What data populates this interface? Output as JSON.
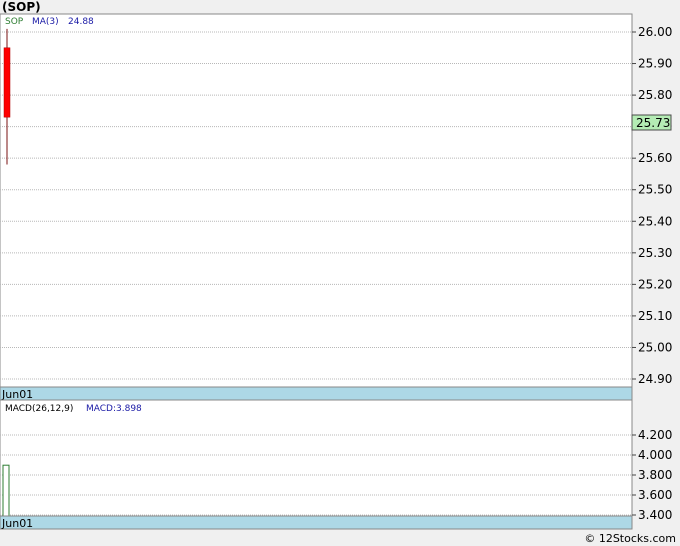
{
  "title": "(SOP)",
  "footer": "© 12Stocks.com",
  "colors": {
    "background": "#ffffff",
    "page": "#f0f0f0",
    "grid": "#b8b8b8",
    "date_band": "#add8e6",
    "down_candle": "#ff0000",
    "current_price_label_bg": "#b4ecb4",
    "ticker_color": "#2e7d32",
    "ma_color": "#1a1aa6",
    "macd_bar": "#2e7d32"
  },
  "price_panel": {
    "ticker_label": "SOP",
    "ma_label": "MA(3)",
    "ma_value": "24.88",
    "current_price": "25.73",
    "date_label": "Jun01"
  },
  "macd_panel": {
    "label": "MACD(26,12,9)",
    "value_label": "MACD:3.898",
    "date_label": "Jun01"
  },
  "chart_data": [
    {
      "type": "candlestick",
      "ylim": [
        24.85,
        26.05
      ],
      "yticks": [
        "26.00",
        "25.90",
        "25.80",
        "25.70",
        "25.60",
        "25.50",
        "25.40",
        "25.30",
        "25.20",
        "25.10",
        "25.00",
        "24.90"
      ],
      "candles": [
        {
          "date": "Jun01",
          "open": 25.95,
          "high": 26.01,
          "low": 25.58,
          "close": 25.73
        }
      ],
      "current_price": 25.73,
      "grid": true
    },
    {
      "type": "bar",
      "ylim": [
        3.35,
        4.3
      ],
      "yticks": [
        "4.200",
        "4.000",
        "3.800",
        "3.600",
        "3.400"
      ],
      "categories": [
        "Jun01"
      ],
      "values": [
        3.898
      ],
      "grid": true
    }
  ]
}
